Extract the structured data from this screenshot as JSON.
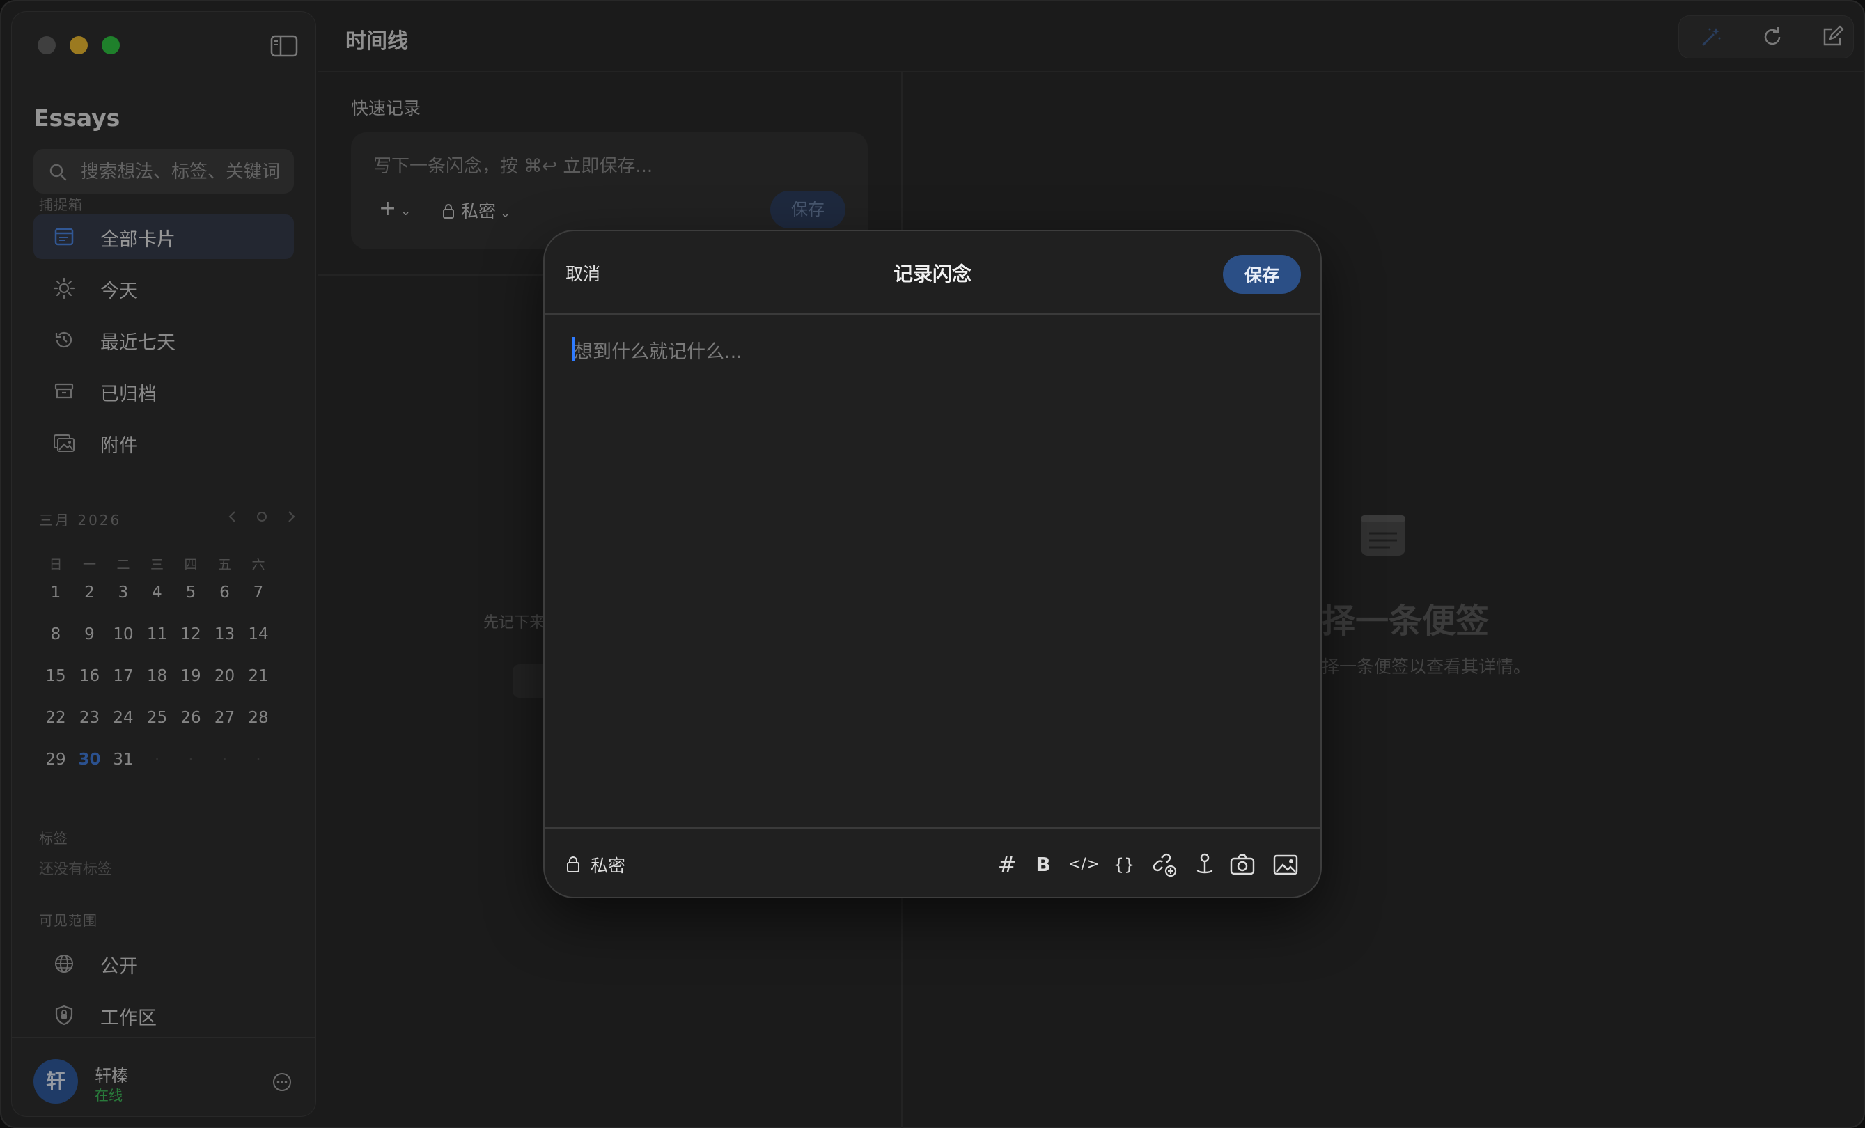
{
  "app": {
    "name": "Essays",
    "header_title": "时间线"
  },
  "search": {
    "placeholder": "搜索想法、标签、关键词"
  },
  "sidebar": {
    "inbox_label": "捕捉箱",
    "items": [
      {
        "label": "全部卡片",
        "icon": "cards-icon",
        "active": true
      },
      {
        "label": "今天",
        "icon": "sun-icon"
      },
      {
        "label": "最近七天",
        "icon": "history-icon"
      },
      {
        "label": "已归档",
        "icon": "archive-icon"
      },
      {
        "label": "附件",
        "icon": "photos-icon"
      }
    ],
    "calendar": {
      "title": "三月 2026",
      "weekdays": [
        "日",
        "一",
        "二",
        "三",
        "四",
        "五",
        "六"
      ],
      "today": 30
    },
    "tags_label": "标签",
    "tags_empty": "还没有标签",
    "visibility_label": "可见范围",
    "visibility_items": [
      {
        "label": "公开",
        "icon": "globe-icon"
      },
      {
        "label": "工作区",
        "icon": "shield-icon"
      }
    ],
    "user": {
      "avatar": "轩",
      "name": "轩榛",
      "status": "在线"
    }
  },
  "quick_record": {
    "label": "快速记录",
    "placeholder": "写下一条闪念，按 ⌘↩ 立即保存...",
    "plus": "+",
    "privacy": "私密",
    "save": "保存"
  },
  "timeline": {
    "empty_text": "先记下来"
  },
  "detail": {
    "title": "择一条便签",
    "subtitle": "择一条便签以查看其详情。"
  },
  "modal": {
    "cancel": "取消",
    "title": "记录闪念",
    "save": "保存",
    "placeholder": "想到什么就记什么...",
    "privacy": "私密",
    "tools": [
      "#",
      "B",
      "</>",
      "{}"
    ]
  },
  "colors": {
    "accent": "#2b4f86",
    "today": "#3f7de0",
    "online": "#3cbf5a"
  }
}
